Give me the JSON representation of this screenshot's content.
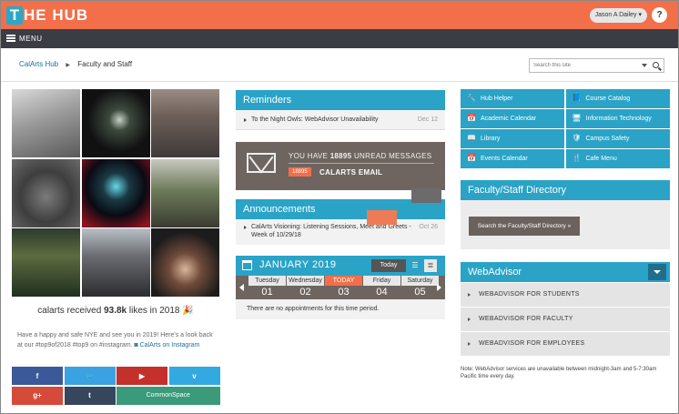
{
  "header": {
    "logo_letter": "T",
    "logo_text": "THE HUB",
    "user_name": "Jason A Dailey ▾",
    "help_label": "?",
    "brand_color": "#f26f4a",
    "accent_color": "#2aa3c7"
  },
  "menu": {
    "label": "MENU"
  },
  "breadcrumb": {
    "root": "CalArts Hub",
    "current": "Faculty and Staff"
  },
  "search": {
    "placeholder": "Search this site"
  },
  "instagram": {
    "caption_prefix": "calarts received",
    "caption_count": "93.8k",
    "caption_suffix": "likes in 2018 🎉",
    "text": "Have a happy and safe NYE and see you in 2019! Here's a look back at our #top9of2018 #top9 on #instagram.",
    "link": "CalArts on Instagram"
  },
  "social": {
    "facebook": "f",
    "twitter": "🐦",
    "youtube": "▶",
    "vimeo": "v",
    "google": "g+",
    "tumblr": "t",
    "commonspace": "CommonSpace"
  },
  "reminders": {
    "title": "Reminders",
    "items": [
      {
        "text": "To the Night Owls: WebAdvisor Unavailability",
        "date": "Dec 12"
      }
    ]
  },
  "email": {
    "message_prefix": "YOU HAVE",
    "unread_count": "18895",
    "message_suffix": "UNREAD MESSAGES",
    "badge": "18895",
    "label": "CALARTS EMAIL"
  },
  "announcements": {
    "title": "Announcements",
    "items": [
      {
        "text": "CalArts Visioning: Listening Sessions, Meet and Greets - Week of 10/29/18",
        "date": "Oct 26"
      }
    ]
  },
  "calendar": {
    "month": "JANUARY 2019",
    "today_label": "Today",
    "list_icon": "☰",
    "grid_icon": "≣",
    "days": [
      {
        "name": "Tuesday",
        "num": "01"
      },
      {
        "name": "Wednesday",
        "num": "02"
      },
      {
        "name": "TODAY",
        "num": "03"
      },
      {
        "name": "Friday",
        "num": "04"
      },
      {
        "name": "Saturday",
        "num": "05"
      }
    ],
    "empty": "There are no appointments for this time period."
  },
  "quicklinks": [
    {
      "icon": "🔧",
      "label": "Hub Helper"
    },
    {
      "icon": "📘",
      "label": "Course Catalog"
    },
    {
      "icon": "📅",
      "label": "Academic Calendar"
    },
    {
      "icon": "🖥",
      "label": "Information Technology"
    },
    {
      "icon": "📖",
      "label": "Library"
    },
    {
      "icon": "🛡",
      "label": "Campus Safety"
    },
    {
      "icon": "📅",
      "label": "Events Calendar"
    },
    {
      "icon": "🍴",
      "label": "Cafe Menu"
    }
  ],
  "directory": {
    "title": "Faculty/Staff Directory",
    "button": "Search the Faculty/Staff Directory »"
  },
  "webadvisor": {
    "title": "WebAdvisor",
    "items": [
      "WEBADVISOR FOR STUDENTS",
      "WEBADVISOR FOR FACULTY",
      "WEBADVISOR FOR EMPLOYEES"
    ],
    "note": "Note: WebAdvisor services are unavailable between midnight-3am and 5-7:30am Pacific time every day."
  }
}
